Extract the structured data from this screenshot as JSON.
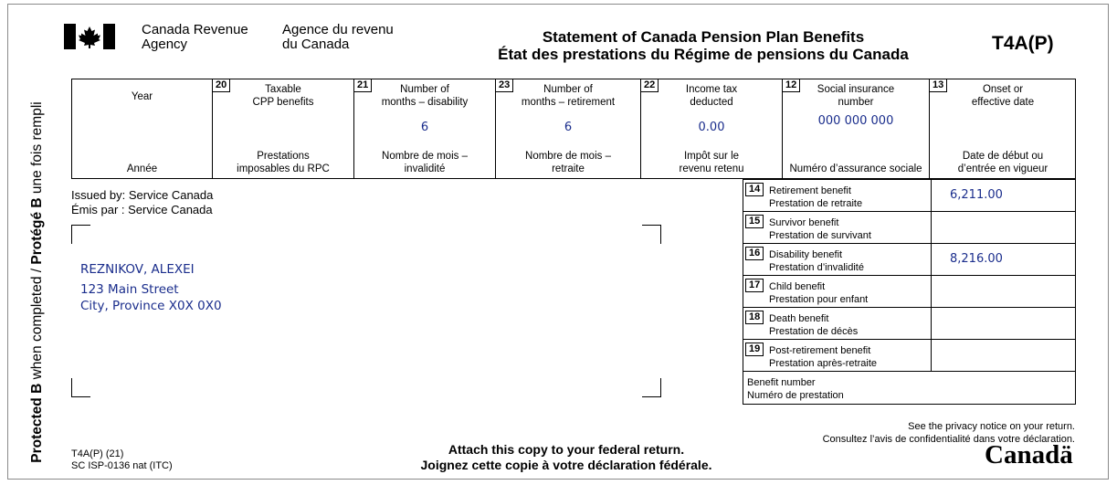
{
  "side_text": {
    "a": "Protected B",
    "b": " when completed / ",
    "c": "Protégé B",
    "d": " une fois rempli"
  },
  "header": {
    "agency_en_1": "Canada Revenue",
    "agency_en_2": "Agency",
    "agency_fr_1": "Agence du revenu",
    "agency_fr_2": "du Canada",
    "title_en": "Statement of Canada Pension Plan Benefits",
    "title_fr": "État des prestations du Régime de pensions du Canada",
    "form_code": "T4A(P)"
  },
  "top_columns": [
    {
      "num": "",
      "en": "Year",
      "fr": "Année",
      "value": ""
    },
    {
      "num": "20",
      "en": "Taxable\nCPP benefits",
      "fr": "Prestations\nimposables du RPC",
      "value": ""
    },
    {
      "num": "21",
      "en": "Number of\nmonths – disability",
      "fr": "Nombre de mois –\ninvalidité",
      "value": "6"
    },
    {
      "num": "23",
      "en": "Number of\nmonths – retirement",
      "fr": "Nombre de mois –\nretraite",
      "value": "6"
    },
    {
      "num": "22",
      "en": "Income tax\ndeducted",
      "fr": "Impôt sur le\nrevenu retenu",
      "value": "0.00"
    },
    {
      "num": "12",
      "en": "Social insurance\nnumber",
      "fr": "Numéro d’assurance sociale",
      "value": "000 000 000"
    },
    {
      "num": "13",
      "en": "Onset or\neffective date",
      "fr": "Date de début ou\nd’entrée en vigueur",
      "value": ""
    }
  ],
  "issued": {
    "en": "Issued by: Service Canada",
    "fr": "Émis par : Service Canada"
  },
  "recipient": {
    "name": "REZNIKOV, ALEXEI",
    "street": "123 Main Street",
    "city": "City, Province  X0X 0X0"
  },
  "benefits": [
    {
      "num": "14",
      "en": "Retirement benefit",
      "fr": "Prestation de retraite",
      "value": "6,211.00"
    },
    {
      "num": "15",
      "en": "Survivor benefit",
      "fr": "Prestation de survivant",
      "value": ""
    },
    {
      "num": "16",
      "en": "Disability benefit",
      "fr": "Prestation d’invalidité",
      "value": "8,216.00"
    },
    {
      "num": "17",
      "en": "Child benefit",
      "fr": "Prestation pour enfant",
      "value": ""
    },
    {
      "num": "18",
      "en": "Death benefit",
      "fr": "Prestation de décès",
      "value": ""
    },
    {
      "num": "19",
      "en": "Post-retirement benefit",
      "fr": "Prestation après-retraite",
      "value": ""
    }
  ],
  "benefit_number": {
    "en": "Benefit number",
    "fr": "Numéro de prestation"
  },
  "privacy": {
    "en": "See the privacy notice on your return.",
    "fr": "Consultez l’avis de confidentialité dans votre déclaration."
  },
  "attach": {
    "en": "Attach this copy to your federal return.",
    "fr": "Joignez cette copie à votre déclaration fédérale."
  },
  "form_footer": {
    "line1": "T4A(P) (21)",
    "line2": "SC ISP-0136 nat (ITC)"
  },
  "wordmark": "Canadä"
}
